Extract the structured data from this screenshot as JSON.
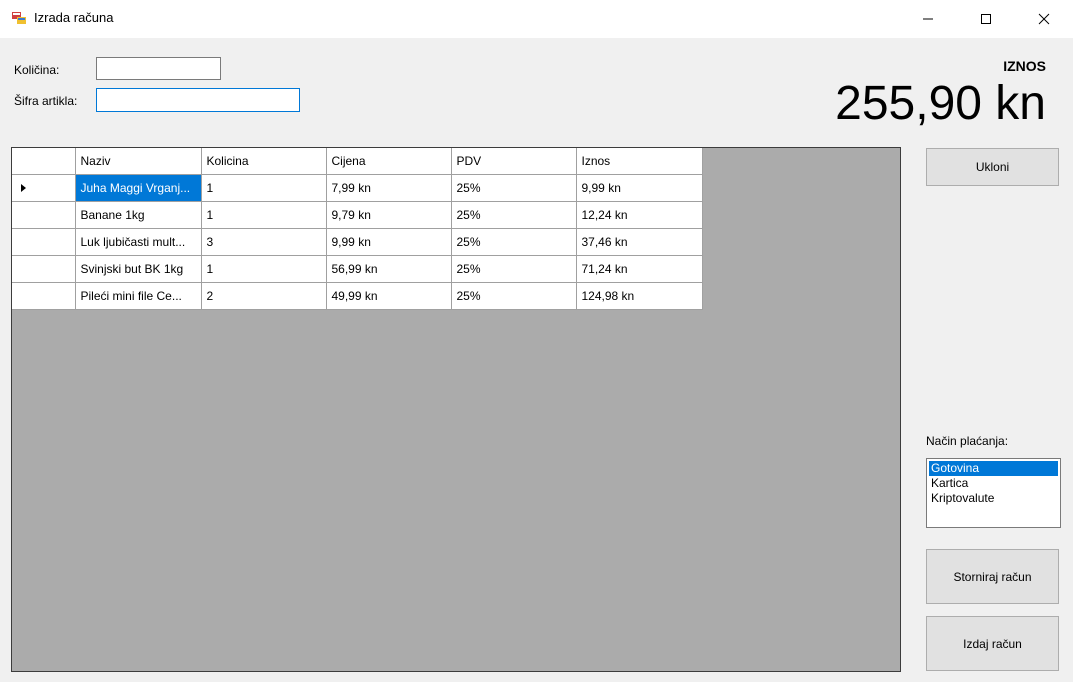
{
  "window": {
    "title": "Izrada računa",
    "colors": {
      "accent": "#0078d7",
      "grid_bg": "#ababab",
      "button_bg": "#e1e1e1"
    },
    "icons": {
      "app": "app-icon",
      "minimize": "minimize-icon",
      "maximize": "maximize-icon",
      "close": "close-icon"
    }
  },
  "form": {
    "kolicina_label": "Količina:",
    "kolicina_value": "",
    "sifra_label": "Šifra artikla:",
    "sifra_value": ""
  },
  "total": {
    "label": "IZNOS",
    "value": "255,90 kn"
  },
  "grid": {
    "columns": [
      "Naziv",
      "Kolicina",
      "Cijena",
      "PDV",
      "Iznos"
    ],
    "rows": [
      [
        "Juha Maggi Vrganj...",
        "1",
        "7,99 kn",
        "25%",
        "9,99 kn"
      ],
      [
        "Banane 1kg",
        "1",
        "9,79 kn",
        "25%",
        "12,24 kn"
      ],
      [
        "Luk ljubičasti mult...",
        "3",
        "9,99 kn",
        "25%",
        "37,46 kn"
      ],
      [
        "Svinjski but BK 1kg",
        "1",
        "56,99 kn",
        "25%",
        "71,24 kn"
      ],
      [
        "Pileći mini file Ce...",
        "2",
        "49,99 kn",
        "25%",
        "124,98 kn"
      ]
    ]
  },
  "buttons": {
    "ukloni": "Ukloni",
    "storniraj": "Storniraj račun",
    "izdaj": "Izdaj račun"
  },
  "payment": {
    "label": "Način plaćanja:",
    "options": [
      "Gotovina",
      "Kartica",
      "Kriptovalute"
    ],
    "selected": "Gotovina"
  }
}
